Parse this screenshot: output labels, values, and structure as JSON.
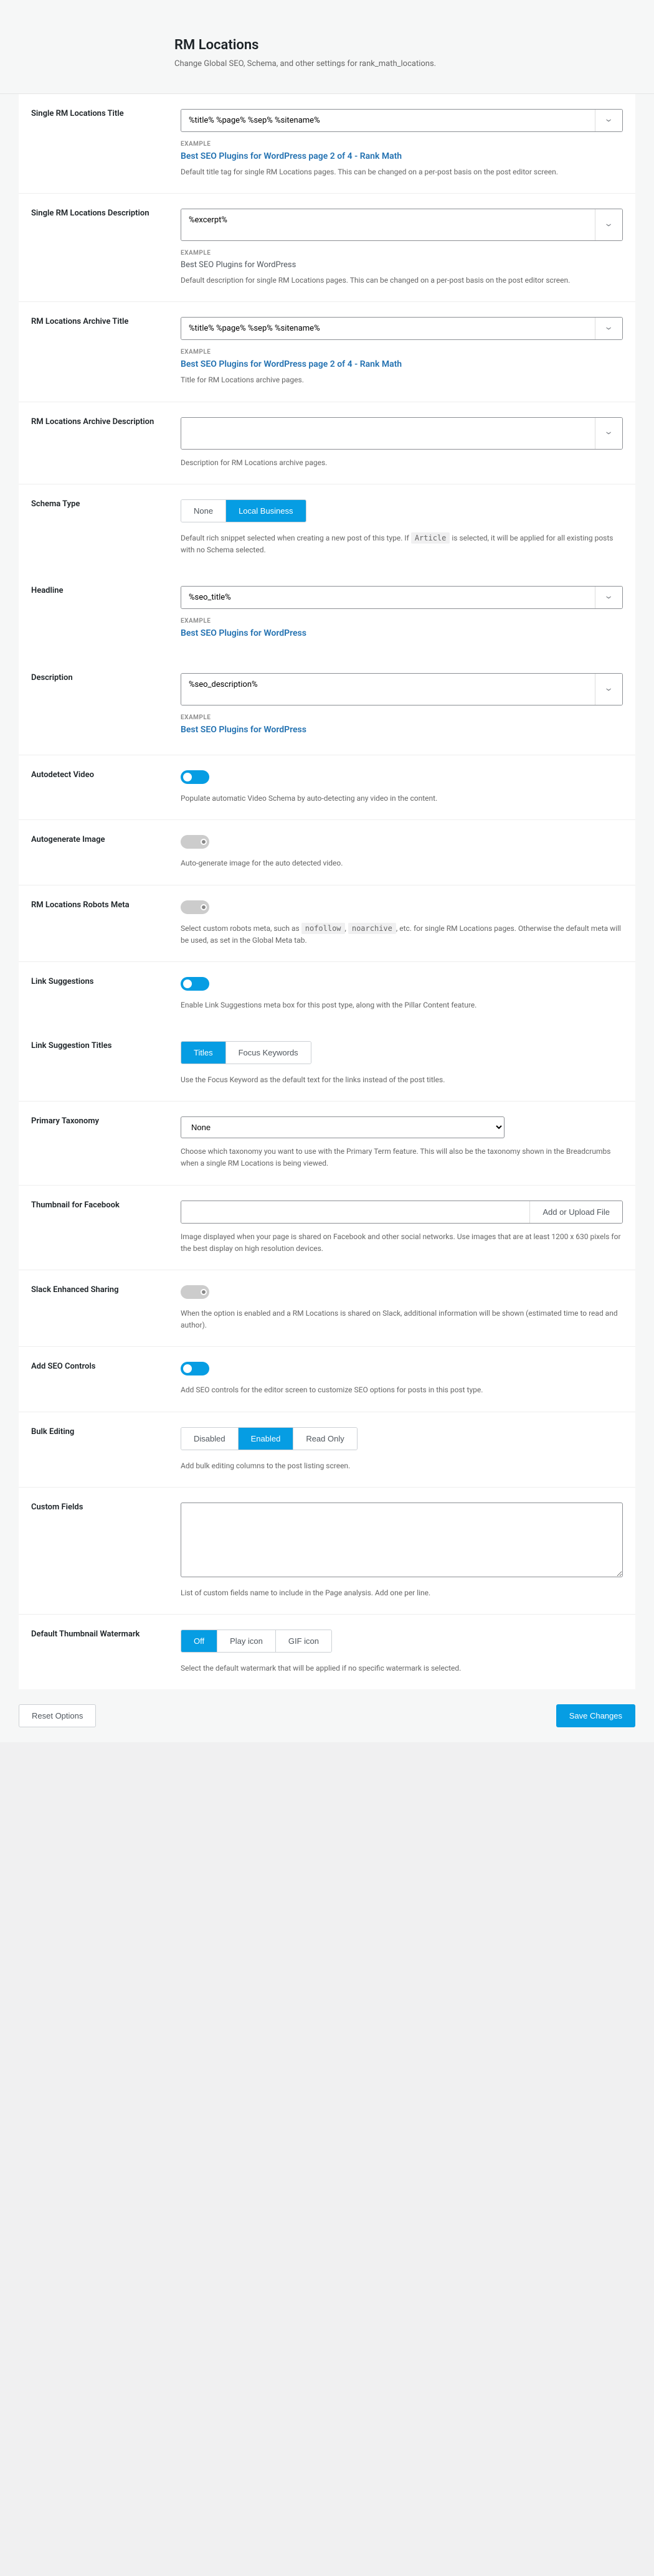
{
  "header": {
    "title": "RM Locations",
    "subtitle": "Change Global SEO, Schema, and other settings for rank_math_locations."
  },
  "labels": {
    "example": "EXAMPLE"
  },
  "fields": {
    "single_title": {
      "label": "Single RM Locations Title",
      "value": "%title% %page% %sep% %sitename%",
      "example": "Best SEO Plugins for WordPress page 2 of 4 - Rank Math",
      "help": "Default title tag for single RM Locations pages. This can be changed on a per-post basis on the post editor screen."
    },
    "single_desc": {
      "label": "Single RM Locations Description",
      "value": "%excerpt%",
      "example": "Best SEO Plugins for WordPress",
      "help": "Default description for single RM Locations pages. This can be changed on a per-post basis on the post editor screen."
    },
    "archive_title": {
      "label": "RM Locations Archive Title",
      "value": "%title% %page% %sep% %sitename%",
      "example": "Best SEO Plugins for WordPress page 2 of 4 - Rank Math",
      "help": "Title for RM Locations archive pages."
    },
    "archive_desc": {
      "label": "RM Locations Archive Description",
      "value": "",
      "help": "Description for RM Locations archive pages."
    },
    "schema_type": {
      "label": "Schema Type",
      "options": [
        "None",
        "Local Business"
      ],
      "active": 1,
      "help_pre": "Default rich snippet selected when creating a new post of this type. If ",
      "help_code": "Article",
      "help_post": " is selected, it will be applied for all existing posts with no Schema selected."
    },
    "headline": {
      "label": "Headline",
      "value": "%seo_title%",
      "example": "Best SEO Plugins for WordPress"
    },
    "description": {
      "label": "Description",
      "value": "%seo_description%",
      "example": "Best SEO Plugins for WordPress"
    },
    "autodetect_video": {
      "label": "Autodetect Video",
      "on": true,
      "help": "Populate automatic Video Schema by auto-detecting any video in the content."
    },
    "autogen_image": {
      "label": "Autogenerate Image",
      "on": false,
      "help": "Auto-generate image for the auto detected video."
    },
    "robots_meta": {
      "label": "RM Locations Robots Meta",
      "on": false,
      "help_pre": "Select custom robots meta, such as ",
      "help_code1": "nofollow",
      "help_mid": ", ",
      "help_code2": "noarchive",
      "help_post": ", etc. for single RM Locations pages. Otherwise the default meta will be used, as set in the Global Meta tab."
    },
    "link_sugg": {
      "label": "Link Suggestions",
      "on": true,
      "help": "Enable Link Suggestions meta box for this post type, along with the Pillar Content feature."
    },
    "link_sugg_titles": {
      "label": "Link Suggestion Titles",
      "options": [
        "Titles",
        "Focus Keywords"
      ],
      "active": 0,
      "help": "Use the Focus Keyword as the default text for the links instead of the post titles."
    },
    "primary_tax": {
      "label": "Primary Taxonomy",
      "value": "None",
      "help": "Choose which taxonomy you want to use with the Primary Term feature. This will also be the taxonomy shown in the Breadcrumbs when a single RM Locations is being viewed."
    },
    "thumbnail_fb": {
      "label": "Thumbnail for Facebook",
      "btn": "Add or Upload File",
      "help": "Image displayed when your page is shared on Facebook and other social networks. Use images that are at least 1200 x 630 pixels for the best display on high resolution devices."
    },
    "slack": {
      "label": "Slack Enhanced Sharing",
      "on": false,
      "help": "When the option is enabled and a RM Locations is shared on Slack, additional information will be shown (estimated time to read and author)."
    },
    "seo_controls": {
      "label": "Add SEO Controls",
      "on": true,
      "help": "Add SEO controls for the editor screen to customize SEO options for posts in this post type."
    },
    "bulk_edit": {
      "label": "Bulk Editing",
      "options": [
        "Disabled",
        "Enabled",
        "Read Only"
      ],
      "active": 1,
      "help": "Add bulk editing columns to the post listing screen."
    },
    "custom_fields": {
      "label": "Custom Fields",
      "help": "List of custom fields name to include in the Page analysis. Add one per line."
    },
    "watermark": {
      "label": "Default Thumbnail Watermark",
      "options": [
        "Off",
        "Play icon",
        "GIF icon"
      ],
      "active": 0,
      "help": "Select the default watermark that will be applied if no specific watermark is selected."
    }
  },
  "footer": {
    "reset": "Reset Options",
    "save": "Save Changes"
  }
}
